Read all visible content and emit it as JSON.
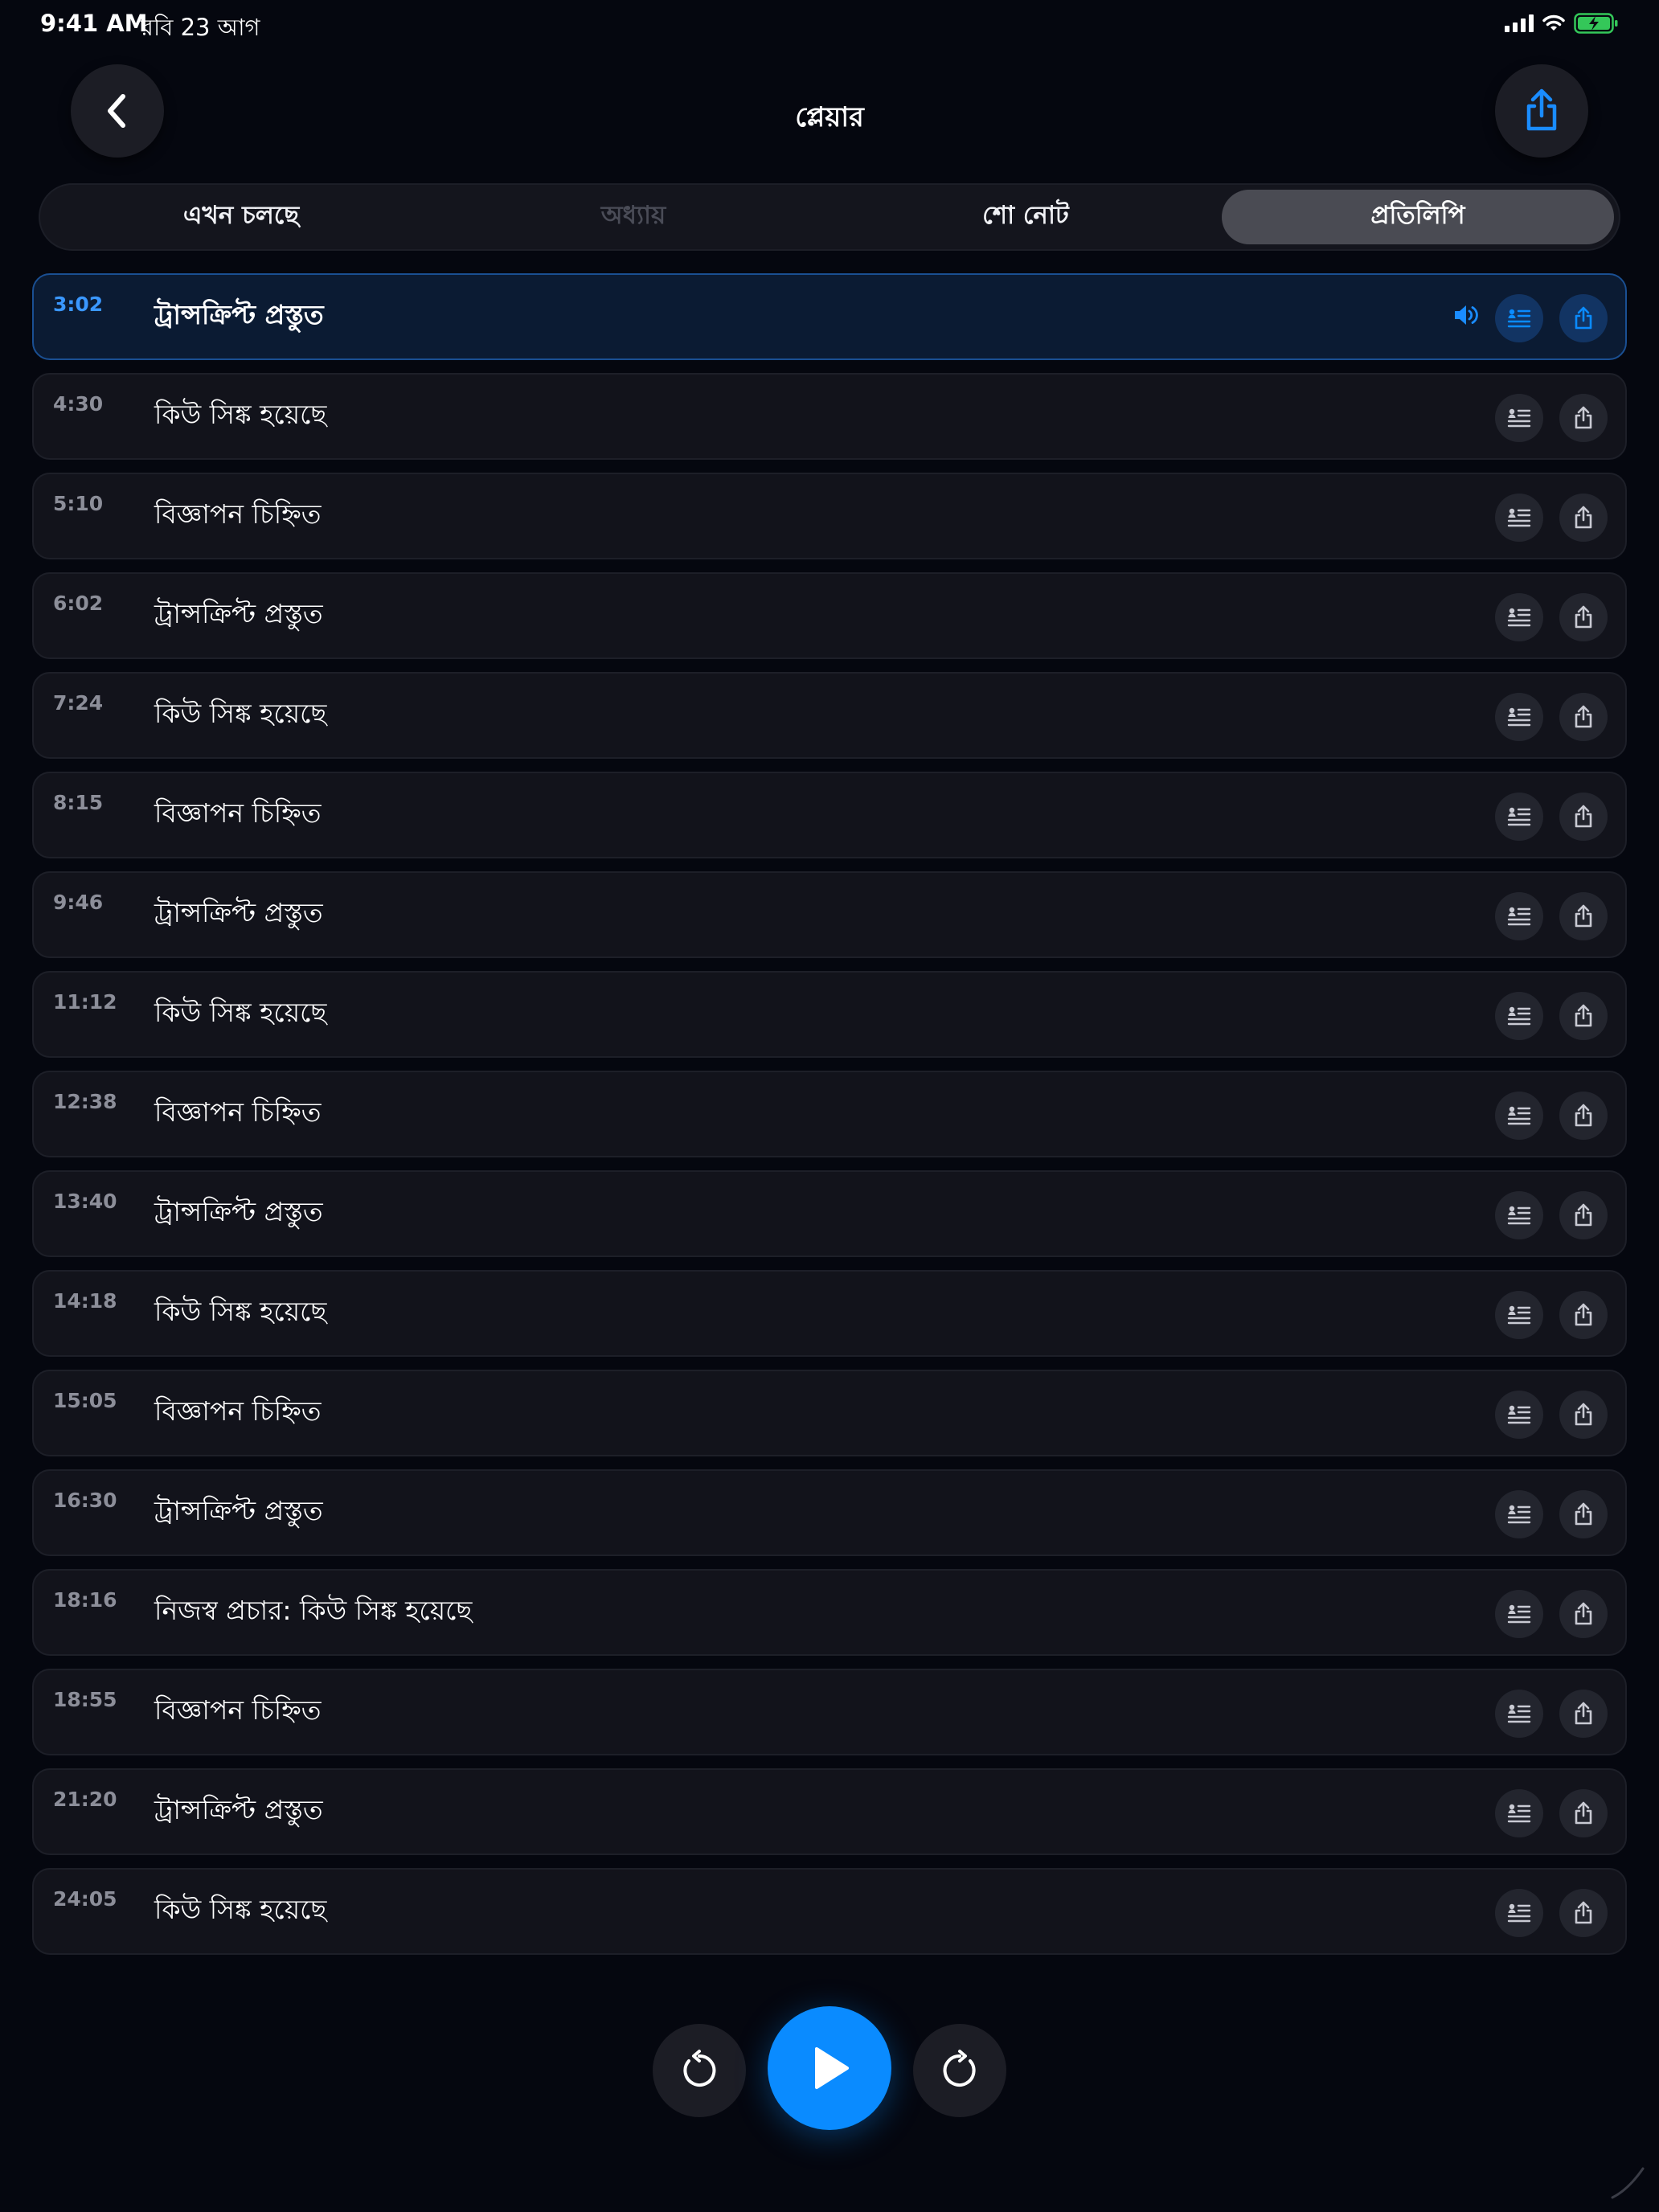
{
  "status_bar": {
    "time": "9:41 AM",
    "date": "রবি 23 আগ"
  },
  "header": {
    "title": "প্লেয়ার"
  },
  "tabs": [
    {
      "label": "এখন চলছে",
      "state": "normal"
    },
    {
      "label": "অধ্যায়",
      "state": "disabled"
    },
    {
      "label": "শো নোট",
      "state": "normal"
    },
    {
      "label": "প্রতিলিপি",
      "state": "selected"
    }
  ],
  "transcript": [
    {
      "time": "3:02",
      "label": "ট্রান্সক্রিপ্ট প্রস্তুত",
      "active": true
    },
    {
      "time": "4:30",
      "label": "কিউ সিঙ্ক হয়েছে"
    },
    {
      "time": "5:10",
      "label": "বিজ্ঞাপন চিহ্নিত"
    },
    {
      "time": "6:02",
      "label": "ট্রান্সক্রিপ্ট প্রস্তুত"
    },
    {
      "time": "7:24",
      "label": "কিউ সিঙ্ক হয়েছে"
    },
    {
      "time": "8:15",
      "label": "বিজ্ঞাপন চিহ্নিত"
    },
    {
      "time": "9:46",
      "label": "ট্রান্সক্রিপ্ট প্রস্তুত"
    },
    {
      "time": "11:12",
      "label": "কিউ সিঙ্ক হয়েছে"
    },
    {
      "time": "12:38",
      "label": "বিজ্ঞাপন চিহ্নিত"
    },
    {
      "time": "13:40",
      "label": "ট্রান্সক্রিপ্ট প্রস্তুত"
    },
    {
      "time": "14:18",
      "label": "কিউ সিঙ্ক হয়েছে"
    },
    {
      "time": "15:05",
      "label": "বিজ্ঞাপন চিহ্নিত"
    },
    {
      "time": "16:30",
      "label": "ট্রান্সক্রিপ্ট প্রস্তুত"
    },
    {
      "time": "18:16",
      "label": "নিজস্ব প্রচার: কিউ সিঙ্ক হয়েছে"
    },
    {
      "time": "18:55",
      "label": "বিজ্ঞাপন চিহ্নিত"
    },
    {
      "time": "21:20",
      "label": "ট্রান্সক্রিপ্ট প্রস্তুত"
    },
    {
      "time": "24:05",
      "label": "কিউ সিঙ্ক হয়েছে"
    }
  ],
  "colors": {
    "accent": "#0a8bff",
    "active_row_bg": "#0b1b33",
    "battery_green": "#34c759"
  },
  "icons": {
    "back": "chevron-left-icon",
    "share": "share-icon",
    "speaker": "speaker-icon",
    "chapters": "chapter-list-icon",
    "rewind": "rewind-icon",
    "play": "play-icon",
    "forward": "forward-icon"
  }
}
